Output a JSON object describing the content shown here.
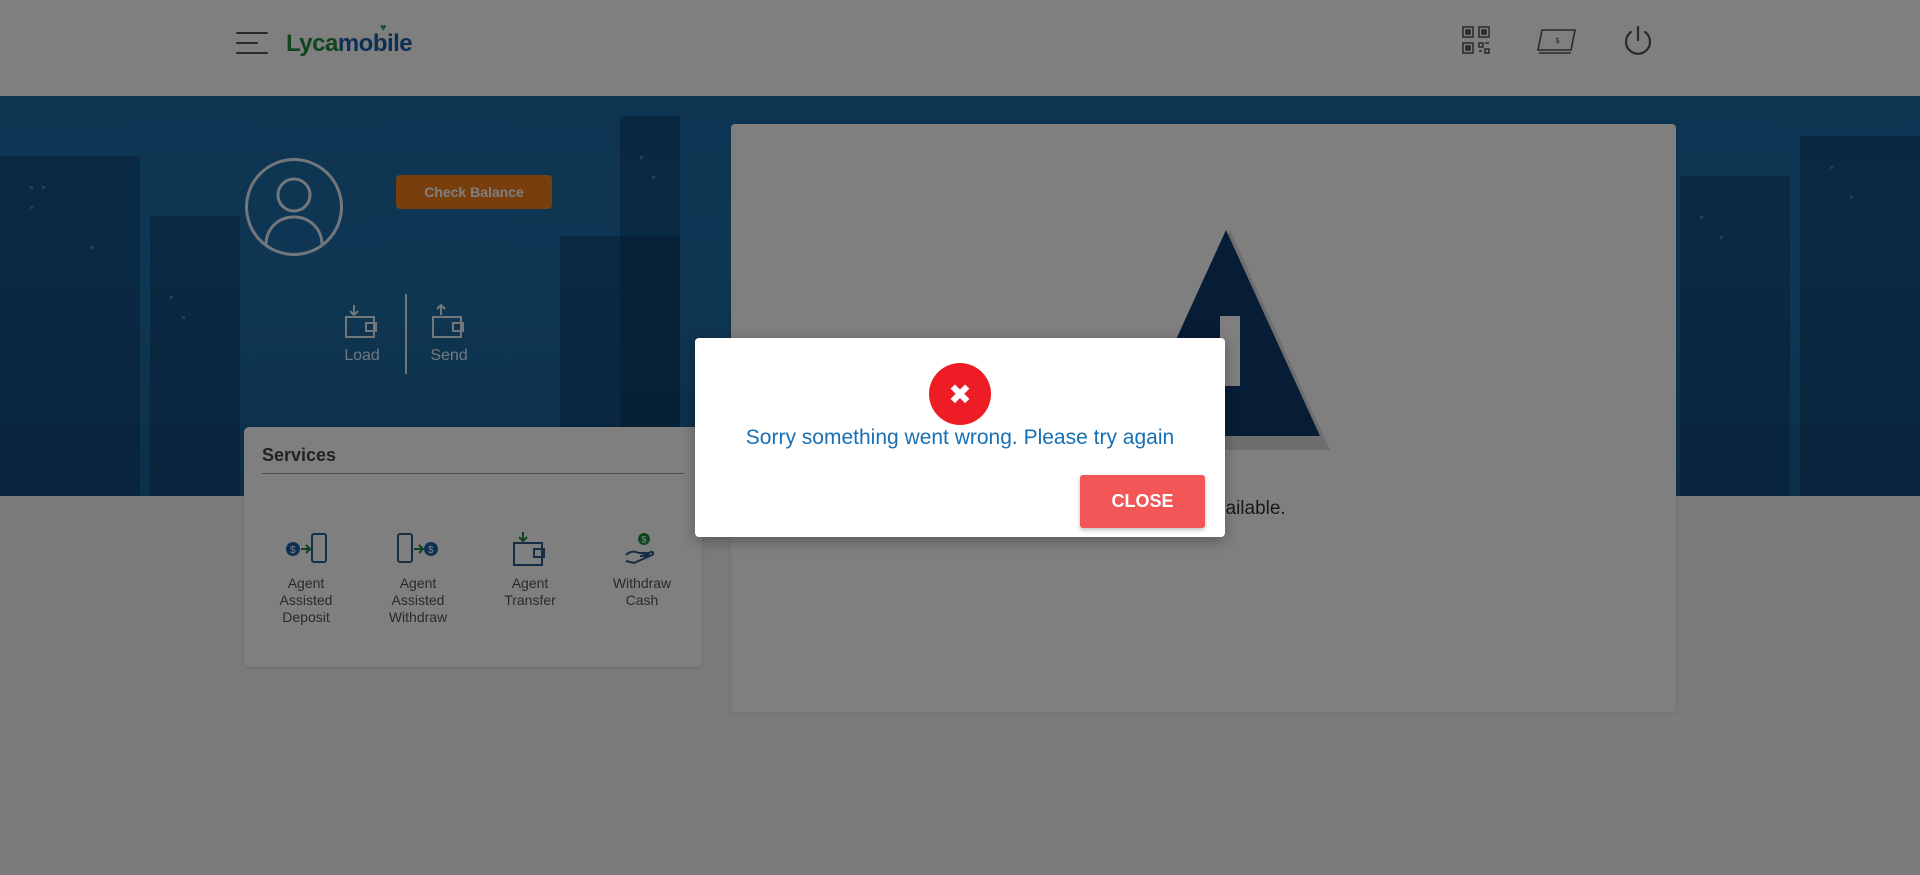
{
  "header": {
    "logo_part1": "Lyca",
    "logo_part2": "mobile",
    "icons": [
      "menu-icon",
      "qr-code-icon",
      "wallet-card-icon",
      "power-icon"
    ]
  },
  "profile": {
    "check_balance_label": "Check Balance",
    "load_label": "Load",
    "send_label": "Send"
  },
  "services": {
    "title": "Services",
    "items": [
      {
        "label_lines": [
          "Agent",
          "Assisted",
          "Deposit"
        ],
        "icon": "agent-assisted-deposit-icon"
      },
      {
        "label_lines": [
          "Agent",
          "Assisted",
          "Withdraw"
        ],
        "icon": "agent-assisted-withdraw-icon"
      },
      {
        "label_lines": [
          "Agent",
          "Transfer"
        ],
        "icon": "agent-transfer-icon"
      },
      {
        "label_lines": [
          "Withdraw",
          "Cash"
        ],
        "icon": "withdraw-cash-icon"
      }
    ]
  },
  "main": {
    "partial_text": "vailable."
  },
  "modal": {
    "message": "Sorry something went wrong. Please try again",
    "close_label": "CLOSE",
    "error_symbol": "✖"
  },
  "colors": {
    "accent_orange": "#f07c1a",
    "error_red": "#ee1c25",
    "close_button": "#f25656",
    "message_blue": "#1870b4",
    "banner_blue": "#1a6aa5"
  }
}
